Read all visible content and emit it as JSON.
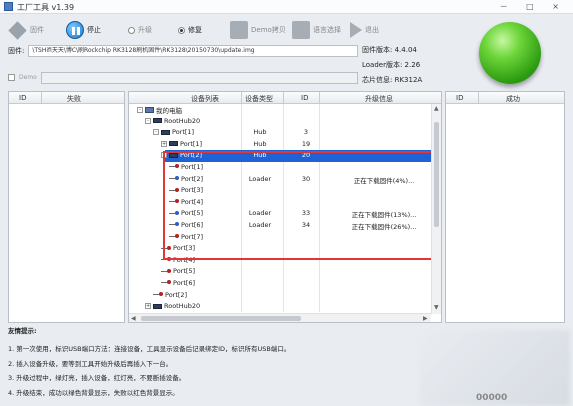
{
  "window": {
    "title": "工厂工具 v1.39",
    "controls": "－ □ ×"
  },
  "toolbar": {
    "items": [
      {
        "label": "固件",
        "icon": "diamond-icon"
      },
      {
        "label": "停止",
        "icon": "pause-icon"
      },
      {
        "label": "升级",
        "icon": "radio-icon"
      },
      {
        "label": "修复",
        "icon": "radio-icon"
      },
      {
        "label": "Demo拷贝",
        "icon": "gear-icon"
      },
      {
        "label": "语言选择",
        "icon": "gear-icon"
      },
      {
        "label": "退出",
        "icon": "arrow-right-icon"
      }
    ]
  },
  "firmware": {
    "label": "固件:",
    "path": "\\TSHifi天天\\博C\\刷Rockchip RK3128刷机固件\\RK3128\\20150730\\update.img"
  },
  "demo": {
    "label": "Demo"
  },
  "info": {
    "firmware_version": "固件版本: 4.4.04",
    "loader_version": "Loader版本: 2.26",
    "chip_info": "芯片信息: RK312A"
  },
  "failed_panel": {
    "col_id": "ID",
    "col_status": "失败"
  },
  "success_panel": {
    "col_id": "ID",
    "col_status": "成功"
  },
  "device_list": {
    "columns": {
      "device": "设备列表",
      "type": "设备类型",
      "id": "ID",
      "status": "升级信息"
    },
    "rows": [
      {
        "indent": 0,
        "toggle": "-",
        "icon": "pc",
        "name": "我的电脑",
        "type": "",
        "id": "",
        "status": ""
      },
      {
        "indent": 1,
        "toggle": "-",
        "icon": "hub",
        "name": "RootHub20",
        "type": "",
        "id": "",
        "status": ""
      },
      {
        "indent": 2,
        "toggle": "-",
        "icon": "hub",
        "name": "Port[1]",
        "type": "Hub",
        "id": "3",
        "status": ""
      },
      {
        "indent": 3,
        "toggle": "+",
        "icon": "hub",
        "name": "Port[1]",
        "type": "Hub",
        "id": "19",
        "status": ""
      },
      {
        "indent": 3,
        "toggle": "-",
        "icon": "hub",
        "name": "Port[2]",
        "type": "Hub",
        "id": "20",
        "status": "",
        "selected": true
      },
      {
        "indent": 4,
        "toggle": "",
        "icon": "port",
        "name": "Port[1]",
        "type": "",
        "id": "",
        "status": ""
      },
      {
        "indent": 4,
        "toggle": "",
        "icon": "port-blue",
        "name": "Port[2]",
        "type": "Loader",
        "id": "30",
        "status": "正在下载固件(4%)..."
      },
      {
        "indent": 4,
        "toggle": "",
        "icon": "port",
        "name": "Port[3]",
        "type": "",
        "id": "",
        "status": ""
      },
      {
        "indent": 4,
        "toggle": "",
        "icon": "port",
        "name": "Port[4]",
        "type": "",
        "id": "",
        "status": ""
      },
      {
        "indent": 4,
        "toggle": "",
        "icon": "port-blue",
        "name": "Port[5]",
        "type": "Loader",
        "id": "33",
        "status": "正在下载固件(13%)..."
      },
      {
        "indent": 4,
        "toggle": "",
        "icon": "port-blue",
        "name": "Port[6]",
        "type": "Loader",
        "id": "34",
        "status": "正在下载固件(26%)..."
      },
      {
        "indent": 4,
        "toggle": "",
        "icon": "port",
        "name": "Port[7]",
        "type": "",
        "id": "",
        "status": ""
      },
      {
        "indent": 3,
        "toggle": "",
        "icon": "port",
        "name": "Port[3]",
        "type": "",
        "id": "",
        "status": ""
      },
      {
        "indent": 3,
        "toggle": "",
        "icon": "port",
        "name": "Port[4]",
        "type": "",
        "id": "",
        "status": ""
      },
      {
        "indent": 3,
        "toggle": "",
        "icon": "port",
        "name": "Port[5]",
        "type": "",
        "id": "",
        "status": ""
      },
      {
        "indent": 3,
        "toggle": "",
        "icon": "port",
        "name": "Port[6]",
        "type": "",
        "id": "",
        "status": ""
      },
      {
        "indent": 2,
        "toggle": "",
        "icon": "port",
        "name": "Port[2]",
        "type": "",
        "id": "",
        "status": ""
      },
      {
        "indent": 1,
        "toggle": "+",
        "icon": "hub",
        "name": "RootHub20",
        "type": "",
        "id": "",
        "status": ""
      }
    ]
  },
  "tips": {
    "title": "友情提示:",
    "lines": [
      "1. 第一次使用，标识USB端口方法：连接设备，工具显示设备后记录绑定ID，标识所有USB端口。",
      "2. 插入设备升级，要等到工具开始升级后再插入下一台。",
      "3. 升级过程中，绿灯亮，插入设备，红灯亮，不要断插设备。",
      "4. 升级结束，成功以绿色背景显示，失败以红色背景显示。"
    ]
  },
  "footer": {
    "count": "00000"
  }
}
